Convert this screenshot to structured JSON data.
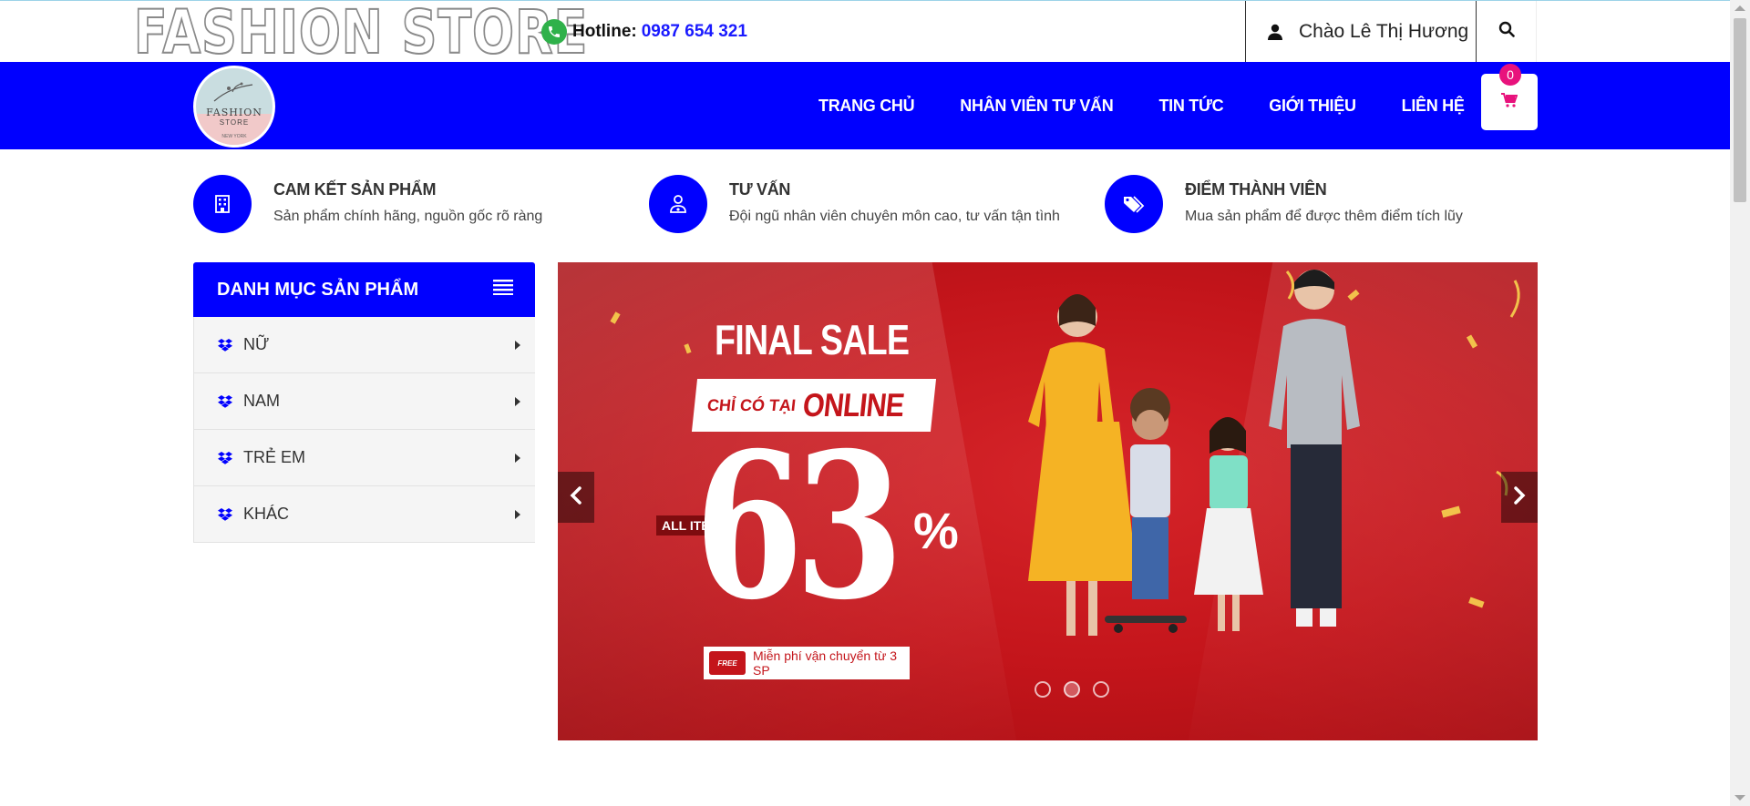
{
  "header": {
    "store_name": "FASHION STORE",
    "hotline_label": "Hotline:",
    "hotline_number": "0987 654 321",
    "greeting": "Chào Lê Thị Hương"
  },
  "nav": {
    "logo_text": "FASHION",
    "logo_sub": "STORE",
    "logo_city": "NEW YORK",
    "items": [
      "TRANG CHỦ",
      "NHÂN VIÊN TƯ VẤN",
      "TIN TỨC",
      "GIỚI THIỆU",
      "LIÊN HỆ"
    ],
    "cart_count": "0"
  },
  "features": [
    {
      "title": "CAM KẾT SẢN PHẨM",
      "desc": "Sản phẩm chính hãng, nguồn gốc rõ ràng",
      "icon": "building-icon"
    },
    {
      "title": "TƯ VẤN",
      "desc": "Đội ngũ nhân viên chuyên môn cao, tư vấn tận tình",
      "icon": "user-md-icon"
    },
    {
      "title": "ĐIỂM THÀNH VIÊN",
      "desc": "Mua sản phẩm để được thêm điểm tích lũy",
      "icon": "tags-icon"
    }
  ],
  "sidebar": {
    "title": "DANH MỤC SẢN PHẨM",
    "items": [
      "NỮ",
      "NAM",
      "TRẺ EM",
      "KHÁC"
    ]
  },
  "banner": {
    "headline": "FINAL SALE",
    "online_prefix": "CHỈ CÓ TẠI",
    "online": "ONLINE",
    "all_items": "ALL ITEMS",
    "percent": "63",
    "percent_sign": "%",
    "free_badge": "FREE",
    "free_ship": "Miễn phí vận chuyển từ 3 SP",
    "slide_count": 3,
    "active_slide": 2
  },
  "colors": {
    "brand_blue": "#0000ff",
    "banner_red": "#c4151b",
    "cart_badge": "#e8127c"
  }
}
